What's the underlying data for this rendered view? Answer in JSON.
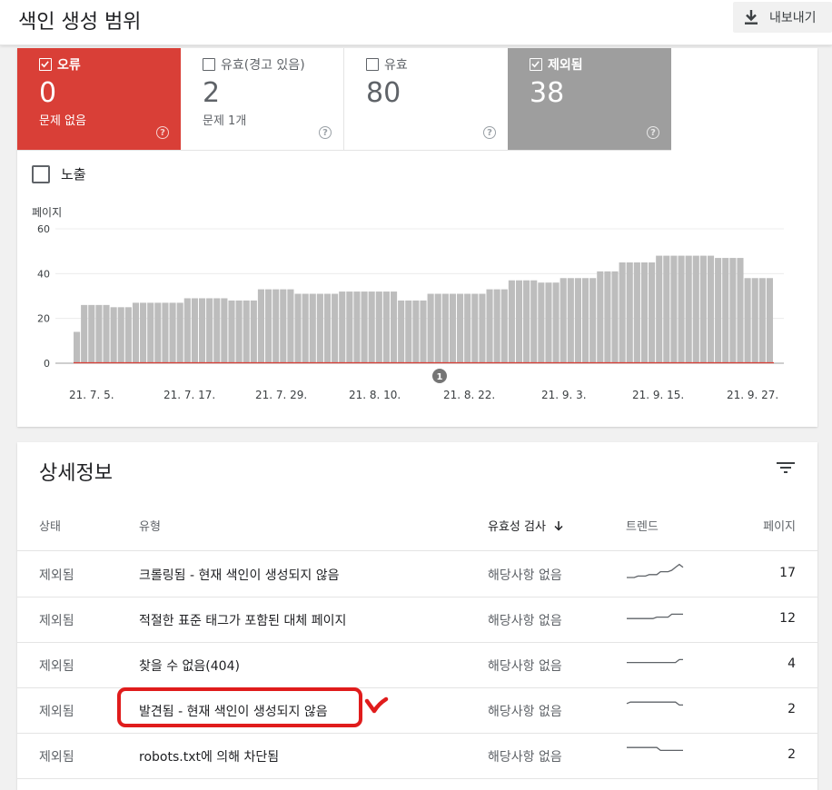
{
  "header": {
    "title": "색인 생성 범위",
    "export_label": "내보내기"
  },
  "summary": {
    "tiles": [
      {
        "label": "오류",
        "value": "0",
        "sub": "문제 없음",
        "checked": true
      },
      {
        "label": "유효(경고 있음)",
        "value": "2",
        "sub": "문제 1개",
        "checked": false
      },
      {
        "label": "유효",
        "value": "80",
        "sub": "",
        "checked": false
      },
      {
        "label": "제외됨",
        "value": "38",
        "sub": "",
        "checked": true
      }
    ],
    "impressions_label": "노출"
  },
  "chart_data": {
    "type": "bar",
    "ylabel": "페이지",
    "ylim": [
      0,
      60
    ],
    "yticks": [
      "60",
      "40",
      "20",
      "0"
    ],
    "xtick_labels": [
      "21. 7. 5.",
      "21. 7. 17.",
      "21. 7. 29.",
      "21. 8. 10.",
      "21. 8. 22.",
      "21. 9. 3.",
      "21. 9. 15.",
      "21. 9. 27."
    ],
    "annotation": "1",
    "series": [
      {
        "color": "#bdbdbd",
        "values": [
          14,
          26,
          26,
          26,
          26,
          25,
          25,
          25,
          27,
          27,
          27,
          27,
          27,
          27,
          27,
          29,
          29,
          29,
          29,
          29,
          29,
          28,
          28,
          28,
          28,
          33,
          33,
          33,
          33,
          33,
          31,
          31,
          31,
          31,
          31,
          31,
          32,
          32,
          32,
          32,
          32,
          32,
          32,
          32,
          28,
          28,
          28,
          28,
          31,
          31,
          31,
          31,
          31,
          31,
          31,
          31,
          33,
          33,
          33,
          37,
          37,
          37,
          37,
          36,
          36,
          36,
          38,
          38,
          38,
          38,
          38,
          41,
          41,
          41,
          45,
          45,
          45,
          45,
          45,
          48,
          48,
          48,
          48,
          48,
          48,
          48,
          48,
          47,
          47,
          47,
          47,
          38,
          38,
          38,
          38
        ]
      },
      {
        "color": "#d93f37",
        "values": [
          0,
          0,
          0,
          0,
          0,
          0,
          0,
          0,
          0,
          0,
          0,
          0,
          0,
          0,
          0,
          0,
          0,
          0,
          0,
          0,
          0,
          0,
          0,
          0,
          0,
          0,
          0,
          0,
          0,
          0,
          0,
          0,
          0,
          0,
          0,
          0,
          0,
          0,
          0,
          0,
          0,
          0,
          0,
          0,
          0,
          0,
          0,
          0,
          0,
          0,
          0,
          0,
          0,
          0,
          0,
          0,
          0,
          0,
          0,
          0,
          0,
          0,
          0,
          0,
          0,
          0,
          0,
          0,
          0,
          0,
          0,
          0,
          0,
          0,
          0,
          0,
          0,
          0,
          0,
          0,
          0,
          0,
          0,
          0,
          0,
          0,
          0,
          0,
          0,
          0,
          0,
          0,
          0,
          0,
          0
        ]
      }
    ]
  },
  "details": {
    "title": "상세정보",
    "columns": {
      "status": "상태",
      "type": "유형",
      "validation": "유효성 검사",
      "trend": "트렌드",
      "pages": "페이지"
    },
    "rows": [
      {
        "status": "제외됨",
        "type": "크롤링됨 - 현재 색인이 생성되지 않음",
        "validation": "해당사항 없음",
        "pages": "17"
      },
      {
        "status": "제외됨",
        "type": "적절한 표준 태그가 포함된 대체 페이지",
        "validation": "해당사항 없음",
        "pages": "12"
      },
      {
        "status": "제외됨",
        "type": "찾을 수 없음(404)",
        "validation": "해당사항 없음",
        "pages": "4"
      },
      {
        "status": "제외됨",
        "type": "발견됨 - 현재 색인이 생성되지 않음",
        "validation": "해당사항 없음",
        "pages": "2"
      },
      {
        "status": "제외됨",
        "type": "robots.txt에 의해 차단됨",
        "validation": "해당사항 없음",
        "pages": "2"
      }
    ],
    "sparklines": [
      [
        10,
        10,
        10,
        9,
        9,
        9,
        8,
        8,
        8,
        6,
        6,
        6,
        5,
        3,
        1,
        3
      ],
      [
        7,
        7,
        7,
        7,
        7,
        7,
        7,
        7,
        6,
        6,
        6,
        6,
        4,
        4,
        4,
        4
      ],
      [
        6,
        6,
        6,
        6,
        6,
        6,
        6,
        6,
        6,
        6,
        6,
        6,
        6,
        6,
        4,
        4
      ],
      [
        3,
        2,
        2,
        2,
        2,
        2,
        2,
        2,
        2,
        2,
        2,
        2,
        2,
        2,
        4,
        4
      ],
      [
        2,
        2,
        2,
        2,
        2,
        2,
        2,
        2,
        2,
        4,
        4,
        4,
        4,
        4,
        4,
        4
      ]
    ]
  }
}
